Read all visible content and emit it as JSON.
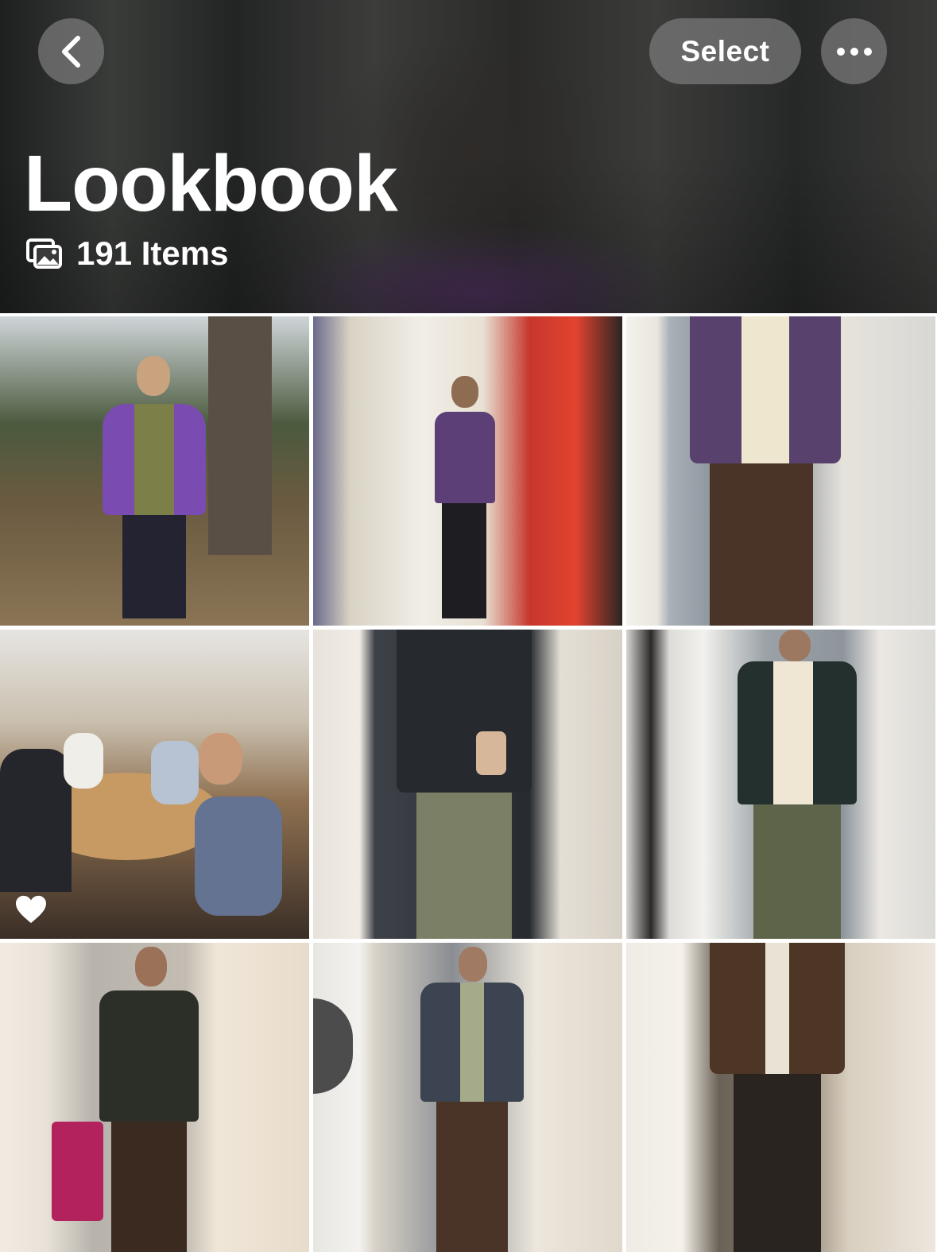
{
  "header": {
    "title": "Lookbook",
    "count_label": "191 Items",
    "select_label": "Select",
    "icons": {
      "back": "chevron-left-icon",
      "more": "ellipsis-icon",
      "count": "photo-stack-icon"
    }
  },
  "photos": [
    {
      "alt": "Person in purple jacket among trees",
      "favorite": false
    },
    {
      "alt": "Mirror selfie in purple varsity jacket by red flags",
      "favorite": false
    },
    {
      "alt": "Mirror selfie in purple jacket and brown pants",
      "favorite": false
    },
    {
      "alt": "Group dinner at round table in restaurant",
      "favorite": true
    },
    {
      "alt": "Mirror selfie in dark jacket and green pants",
      "favorite": false
    },
    {
      "alt": "Mirror selfie in dark fleece and camo pants",
      "favorite": false
    },
    {
      "alt": "Mirror selfie in dark jacket with pink suitcase",
      "favorite": false
    },
    {
      "alt": "Mirror selfie in patchwork jacket by washer",
      "favorite": false
    },
    {
      "alt": "Mirror selfie in brown jacket by bookshelf",
      "favorite": false
    }
  ],
  "colors": {
    "accent": "#ffffff",
    "button_bg": "#787878"
  }
}
